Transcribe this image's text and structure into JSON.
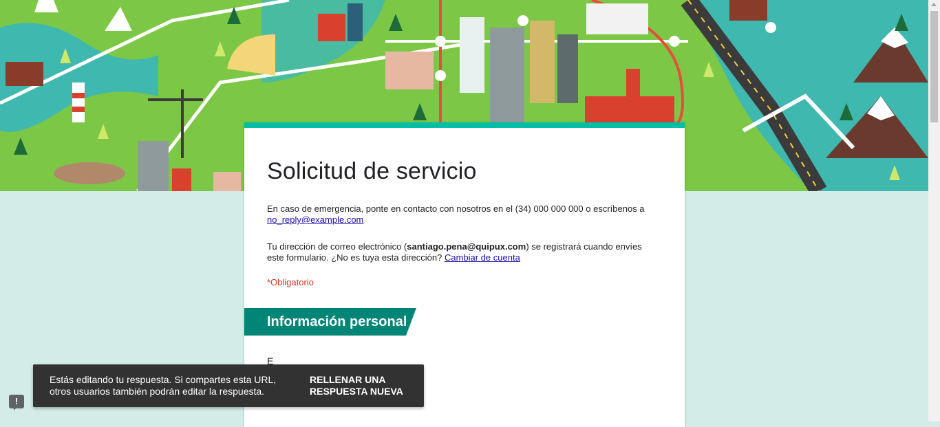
{
  "form": {
    "title": "Solicitud de servicio",
    "description": {
      "text": "En caso de emergencia, ponte en contacto con nosotros en el (34) 000 000 000 o escríbenos a",
      "email_link": "no_reply@example.com"
    },
    "account_notice": {
      "prefix": "Tu dirección de correo electrónico (",
      "email": "santiago.pena@quipux.com",
      "suffix": ") se registrará cuando envíes este formulario. ¿No es tuya esta dirección?",
      "change_account_link": "Cambiar de cuenta"
    },
    "required_notice": "*Obligatorio",
    "section": {
      "title": "Información personal"
    },
    "first_question_label": "E"
  },
  "snackbar": {
    "message": "Estás editando tu respuesta. Si compartes esta URL, otros usuarios también podrán editar la respuesta.",
    "action": "Rellenar una respuesta nueva"
  },
  "feedback": {
    "icon": "feedback-icon",
    "glyph": "!"
  },
  "colors": {
    "accent": "#00bfa5",
    "section": "#008577",
    "background": "#d3ece8",
    "required": "#d93025",
    "link": "#1a0dab"
  }
}
